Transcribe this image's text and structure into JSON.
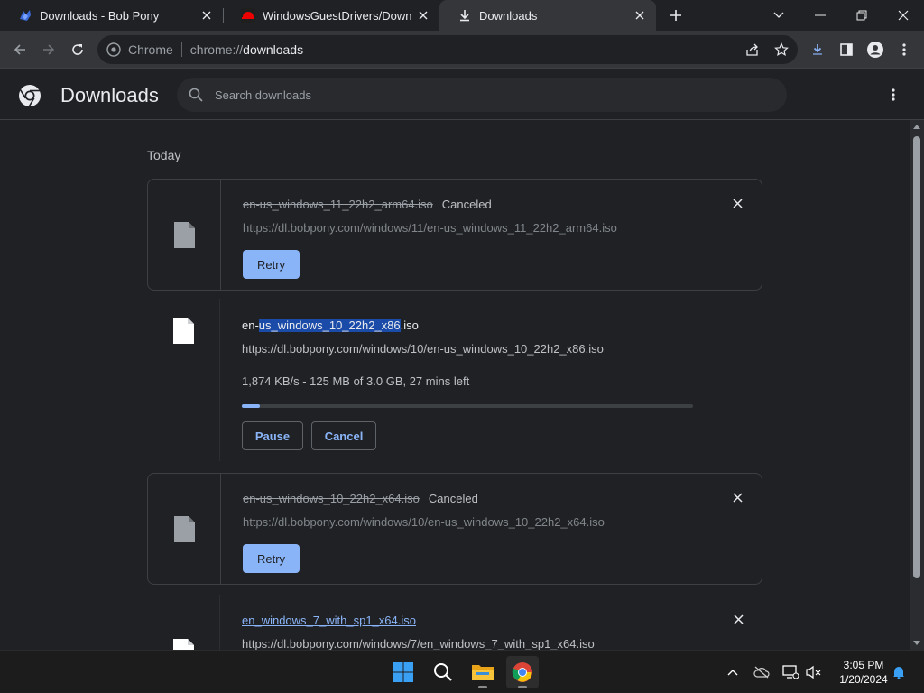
{
  "tabs": [
    {
      "title": "Downloads - Bob Pony",
      "active": false
    },
    {
      "title": "WindowsGuestDrivers/Download",
      "active": false
    },
    {
      "title": "Downloads",
      "active": true
    }
  ],
  "omnibox": {
    "chip": "Chrome",
    "scheme": "chrome://",
    "host": "downloads"
  },
  "page": {
    "title": "Downloads",
    "search_placeholder": "Search downloads"
  },
  "day_label": "Today",
  "downloads": [
    {
      "name": "en-us_windows_11_22h2_arm64.iso",
      "status": "Canceled",
      "url": "https://dl.bobpony.com/windows/11/en-us_windows_11_22h2_arm64.iso",
      "action": "Retry"
    },
    {
      "name_prefix": "en-",
      "name_selected": "us_windows_10_22h2_x86",
      "name_suffix": ".iso",
      "url": "https://dl.bobpony.com/windows/10/en-us_windows_10_22h2_x86.iso",
      "progress_text": "1,874 KB/s - 125 MB of 3.0 GB, 27 mins left",
      "progress": 0.04,
      "pause_label": "Pause",
      "cancel_label": "Cancel"
    },
    {
      "name": "en-us_windows_10_22h2_x64.iso",
      "status": "Canceled",
      "url": "https://dl.bobpony.com/windows/10/en-us_windows_10_22h2_x64.iso",
      "action": "Retry"
    },
    {
      "name": "en_windows_7_with_sp1_x64.iso",
      "url": "https://dl.bobpony.com/windows/7/en_windows_7_with_sp1_x64.iso"
    }
  ],
  "taskbar": {
    "items": [
      "windows-start-icon",
      "search-icon",
      "file-explorer-icon",
      "chrome-icon"
    ],
    "time": "3:05 PM",
    "date": "1/20/2024"
  },
  "colors": {
    "accent": "#8ab4f8",
    "background": "#202124",
    "selection": "#1a4ba8"
  }
}
